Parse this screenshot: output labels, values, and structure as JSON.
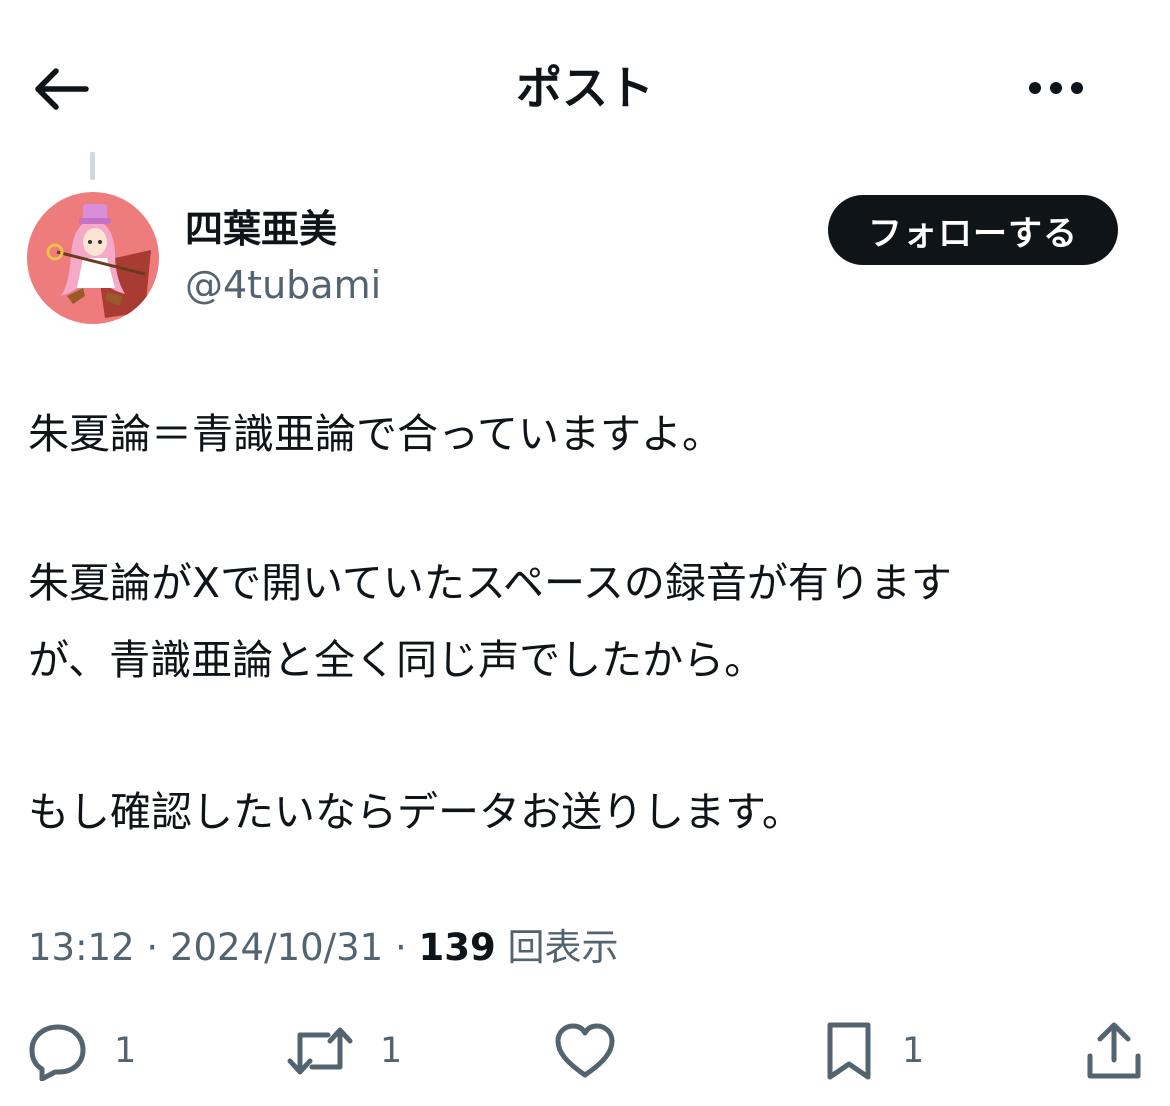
{
  "header": {
    "title": "ポスト",
    "back_icon": "arrow-left-icon",
    "more_icon": "more-horizontal-icon"
  },
  "author": {
    "display_name": "四葉亜美",
    "handle": "@4tubami",
    "avatar_colors": {
      "bg": "#f08080",
      "hair": "#f3a6c6"
    }
  },
  "follow_button": {
    "label": "フォローする",
    "bg": "#0f1419",
    "fg": "#ffffff"
  },
  "post": {
    "lines": [
      "朱夏論＝青識亜論で合っていますよ。",
      "",
      "朱夏論がXで開いていたスペースの録音が有ります",
      "が、青識亜論と全く同じ声でしたから。",
      "",
      "もし確認したいならデータお送りします。"
    ]
  },
  "meta": {
    "time": "13:12",
    "separator": "·",
    "date": "2024/10/31",
    "views_count": "139",
    "views_label": "回表示"
  },
  "actions": {
    "reply": {
      "icon": "reply-icon",
      "count": "1"
    },
    "repost": {
      "icon": "repost-icon",
      "count": "1"
    },
    "like": {
      "icon": "heart-icon",
      "count": ""
    },
    "bookmark": {
      "icon": "bookmark-icon",
      "count": "1"
    },
    "share": {
      "icon": "share-icon",
      "count": ""
    }
  },
  "colors": {
    "text": "#0f1419",
    "secondary": "#536471",
    "icon": "#536471"
  }
}
